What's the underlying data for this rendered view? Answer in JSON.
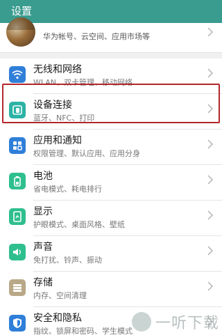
{
  "header": {
    "title": "设置"
  },
  "account": {
    "subtitle": "华为帐号、云空间、应用市场等"
  },
  "items": [
    {
      "label": "无线和网络",
      "sub": "WLAN、双卡管理、移动网络",
      "icon": "wifi-icon",
      "color": "#2f7fd9"
    },
    {
      "label": "设备连接",
      "sub": "蓝牙、NFC、打印",
      "icon": "device-connection-icon",
      "color": "#2bb3a5"
    },
    {
      "label": "应用和通知",
      "sub": "权限管理、默认应用、应用分身",
      "icon": "apps-grid-icon",
      "color": "#2f7fd9"
    },
    {
      "label": "电池",
      "sub": "省电模式、耗电排行",
      "icon": "battery-icon",
      "color": "#2fbf8f"
    },
    {
      "label": "显示",
      "sub": "护眼模式、桌面风格、壁纸",
      "icon": "display-icon",
      "color": "#2fbf8f"
    },
    {
      "label": "声音",
      "sub": "免打扰、铃声、振动",
      "icon": "sound-icon",
      "color": "#2fbf8f"
    },
    {
      "label": "存储",
      "sub": "内存、空间清理",
      "icon": "storage-icon",
      "color": "#b8a888"
    },
    {
      "label": "安全和隐私",
      "sub": "指纹、锁屏和密码、学生模式",
      "icon": "shield-icon",
      "color": "#2f7fd9"
    }
  ],
  "watermark": {
    "text": "一听下载"
  }
}
